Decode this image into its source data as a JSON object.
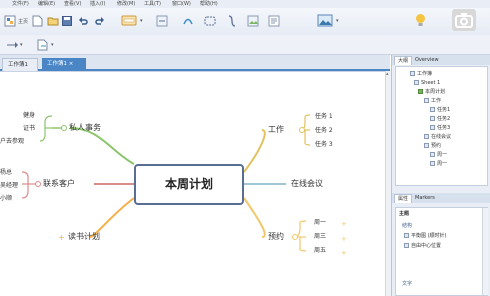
{
  "menu": [
    "文件(F)",
    "编辑(E)",
    "查看(V)",
    "插入(I)",
    "修改(M)",
    "工具(T)",
    "窗口(W)",
    "帮助(H)"
  ],
  "toolbar": {
    "home_label": "主页"
  },
  "tabs": [
    "工作簿1",
    "工作簿1 ×"
  ],
  "map": {
    "central": "本周计划",
    "left_topics": [
      "私人事务",
      "联系客户",
      "读书计划"
    ],
    "right_topics": [
      "工作",
      "在线会议",
      "预约"
    ],
    "private_leaves": [
      "健身",
      "证书",
      "户去参观"
    ],
    "contact_leaves": [
      "杨总",
      "吴经理",
      "小顺"
    ],
    "work_leaves": [
      "任务 1",
      "任务 2",
      "任务 3"
    ],
    "appt_leaves": [
      "周一",
      "周三",
      "周五"
    ]
  },
  "panel": {
    "outline_tabs": [
      "大纲",
      "Overview"
    ],
    "outline_items": [
      "工作簿",
      "Sheet 1",
      "本周计划",
      "工作",
      "任务1",
      "任务2",
      "任务3",
      "在线会议",
      "预约",
      "周一",
      "周一"
    ],
    "props_tabs": [
      "属性",
      "Markers"
    ],
    "props_title": "主题",
    "props_section": "结构",
    "props_items": [
      "平衡图 (顺时针)",
      "自由中心位置"
    ],
    "props_footer": "文字"
  },
  "colors": {
    "accent": "#4a86c5",
    "branch_left_top": "#8cc56c",
    "branch_left_mid": "#d98d8a",
    "branch_left_bottom": "#f5b04a",
    "branch_right_top": "#e2c15e",
    "branch_right_mid": "#9fc7d6",
    "branch_right_bottom": "#f1c86a"
  }
}
